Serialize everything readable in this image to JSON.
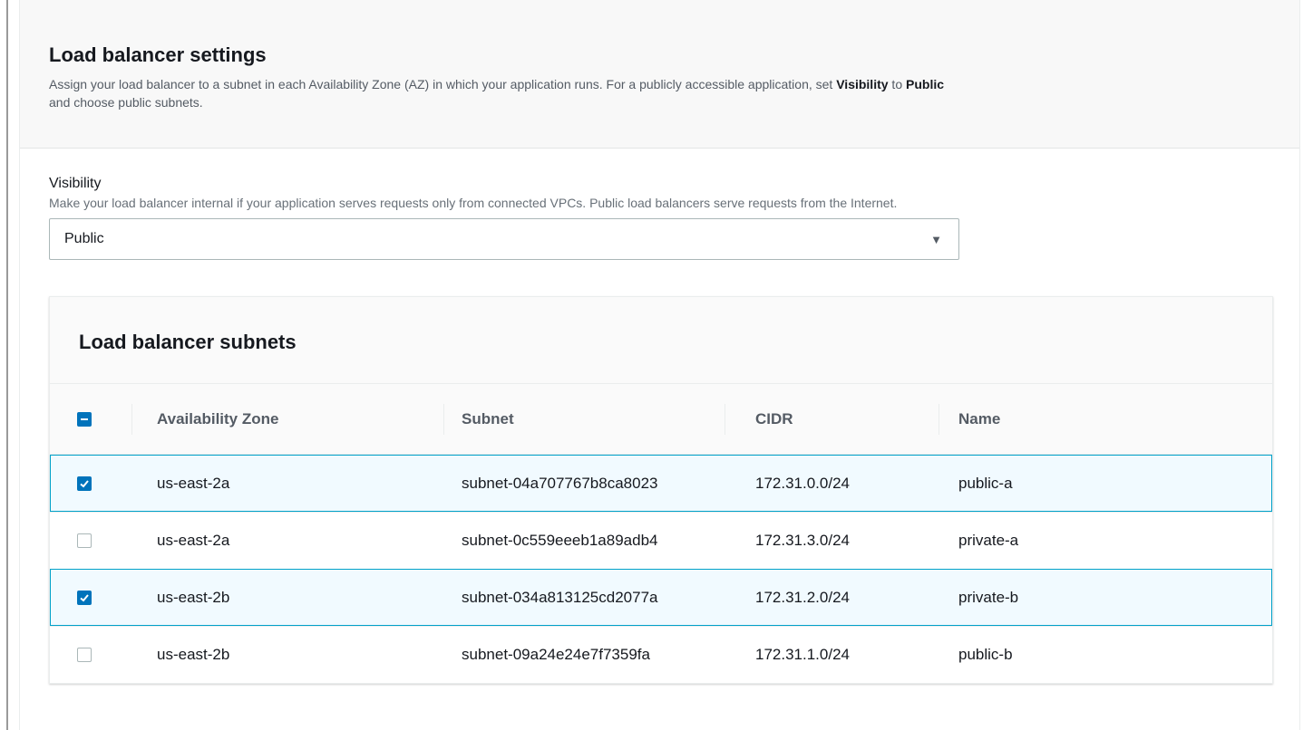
{
  "settings": {
    "title": "Load balancer settings",
    "description_prefix": "Assign your load balancer to a subnet in each Availability Zone (AZ) in which your application runs. For a publicly accessible application, set ",
    "description_bold1": "Visibility",
    "description_mid": " to ",
    "description_bold2": "Public",
    "description_suffix": " and choose public subnets."
  },
  "visibility": {
    "label": "Visibility",
    "help": "Make your load balancer internal if your application serves requests only from connected VPCs. Public load balancers serve requests from the Internet.",
    "value": "Public",
    "arrow_icon": "caret-down-icon"
  },
  "subnets": {
    "title": "Load balancer subnets",
    "columns": [
      "Availability Zone",
      "Subnet",
      "CIDR",
      "Name"
    ],
    "select_all_state": "indeterminate",
    "rows": [
      {
        "checked": true,
        "az": "us-east-2a",
        "subnet": "subnet-04a707767b8ca8023",
        "cidr": "172.31.0.0/24",
        "name": "public-a"
      },
      {
        "checked": false,
        "az": "us-east-2a",
        "subnet": "subnet-0c559eeeb1a89adb4",
        "cidr": "172.31.3.0/24",
        "name": "private-a"
      },
      {
        "checked": true,
        "az": "us-east-2b",
        "subnet": "subnet-034a813125cd2077a",
        "cidr": "172.31.2.0/24",
        "name": "private-b"
      },
      {
        "checked": false,
        "az": "us-east-2b",
        "subnet": "subnet-09a24e24e7f7359fa",
        "cidr": "172.31.1.0/24",
        "name": "public-b"
      }
    ]
  },
  "colors": {
    "accent": "#0073bb",
    "selected_row_bg": "#f1faff",
    "selected_row_border": "#00a1c9"
  }
}
